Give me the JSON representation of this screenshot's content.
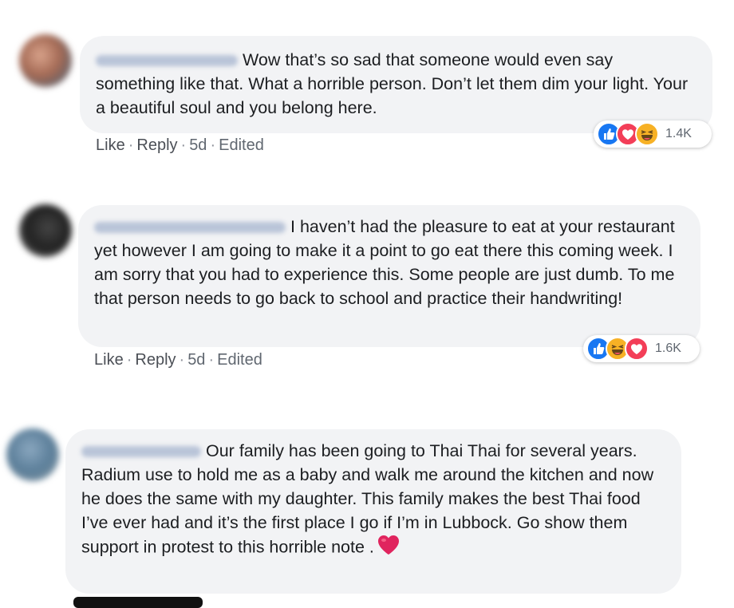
{
  "comments": [
    {
      "text": "Wow that’s so sad that someone would even say something like that. What a horrible person. Don’t let them dim your light. Your a beautiful soul and you belong here.",
      "actions": {
        "like": "Like",
        "reply": "Reply",
        "time": "5d",
        "edited": "Edited"
      },
      "reactions": {
        "icons": [
          "like-icon",
          "love-icon",
          "haha-icon"
        ],
        "count": "1.4K"
      }
    },
    {
      "text": "I haven’t had the pleasure to eat at your restaurant yet however I am going to make it a point to go eat there this coming week. I am sorry that you had to experience this. Some people are just dumb. To me that person needs to go back to school and practice their handwriting!",
      "actions": {
        "like": "Like",
        "reply": "Reply",
        "time": "5d",
        "edited": "Edited"
      },
      "reactions": {
        "icons": [
          "like-icon",
          "haha-icon",
          "love-icon"
        ],
        "count": "1.6K"
      }
    },
    {
      "text": "Our family has been going to Thai Thai for several years. Radium use to hold me as a baby and walk me around the kitchen and now he does the same with my daughter. This family makes the best Thai food I’ve ever had and it’s the first place I go if I’m in Lubbock. Go show them support in protest to this horrible note .",
      "emoji": "heart-emoji"
    }
  ],
  "colors": {
    "bubble": "#f2f3f5",
    "link": "#4b4f56",
    "like_blue": "#1877f2",
    "love_red": "#f33e58",
    "haha_yellow": "#f7b125"
  }
}
